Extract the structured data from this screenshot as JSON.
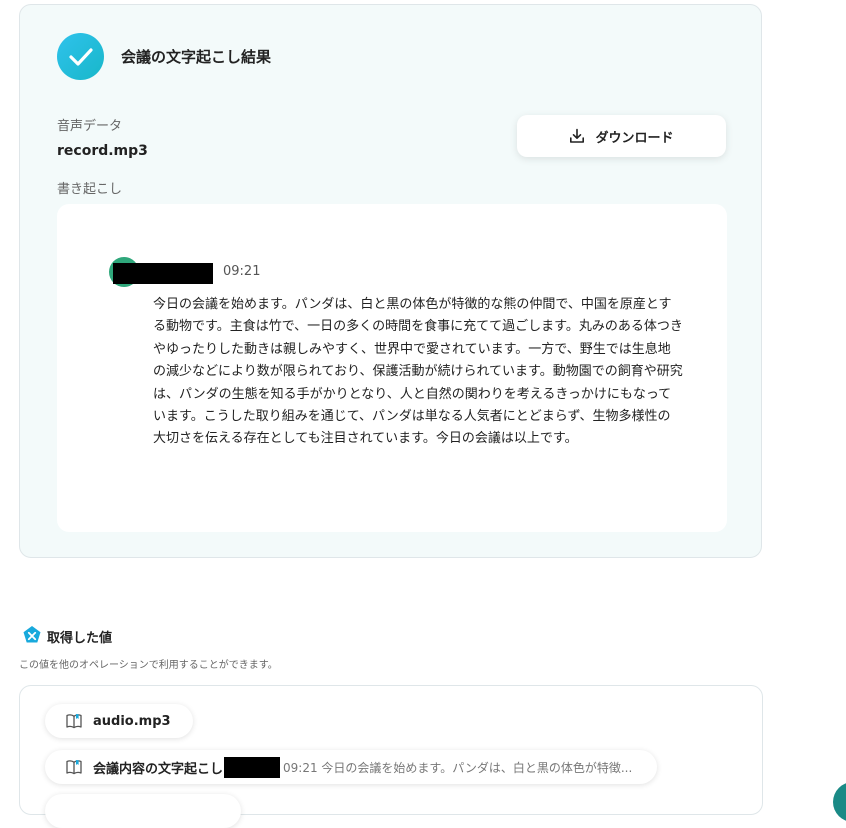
{
  "result": {
    "title": "会議の文字起こし結果",
    "audio_label": "音声データ",
    "file_name": "record.mp3",
    "download_label": "ダウンロード",
    "transcript_label": "書き起こし",
    "message": {
      "time": "09:21",
      "text": "今日の会議を始めます。パンダは、白と黒の体色が特徴的な熊の仲間で、中国を原産とする動物です。主食は竹で、一日の多くの時間を食事に充てて過ごします。丸みのある体つきやゆったりした動きは親しみやすく、世界中で愛されています。一方で、野生では生息地の減少などにより数が限られており、保護活動が続けられています。動物園での飼育や研究は、パンダの生態を知る手がかりとなり、人と自然の関わりを考えるきっかけにもなっています。こうした取り組みを通じて、パンダは単なる人気者にとどまらず、生物多様性の大切さを伝える存在としても注目されています。今日の会議は以上です。"
    }
  },
  "values": {
    "title": "取得した値",
    "description": "この値を他のオペレーションで利用することができます。",
    "chips": [
      {
        "name": "audio.mp3",
        "preview": ""
      },
      {
        "name": "会議内容の文字起こし",
        "preview": "09:21 今日の会議を始めます。パンダは、白と黒の体色が特徴..."
      }
    ]
  },
  "colors": {
    "accent": "#18b7c9",
    "card_bg": "#f3fafa",
    "avatar": "#2fa77b"
  },
  "icons": [
    "check-icon",
    "download-icon",
    "variable-icon",
    "book-icon"
  ]
}
